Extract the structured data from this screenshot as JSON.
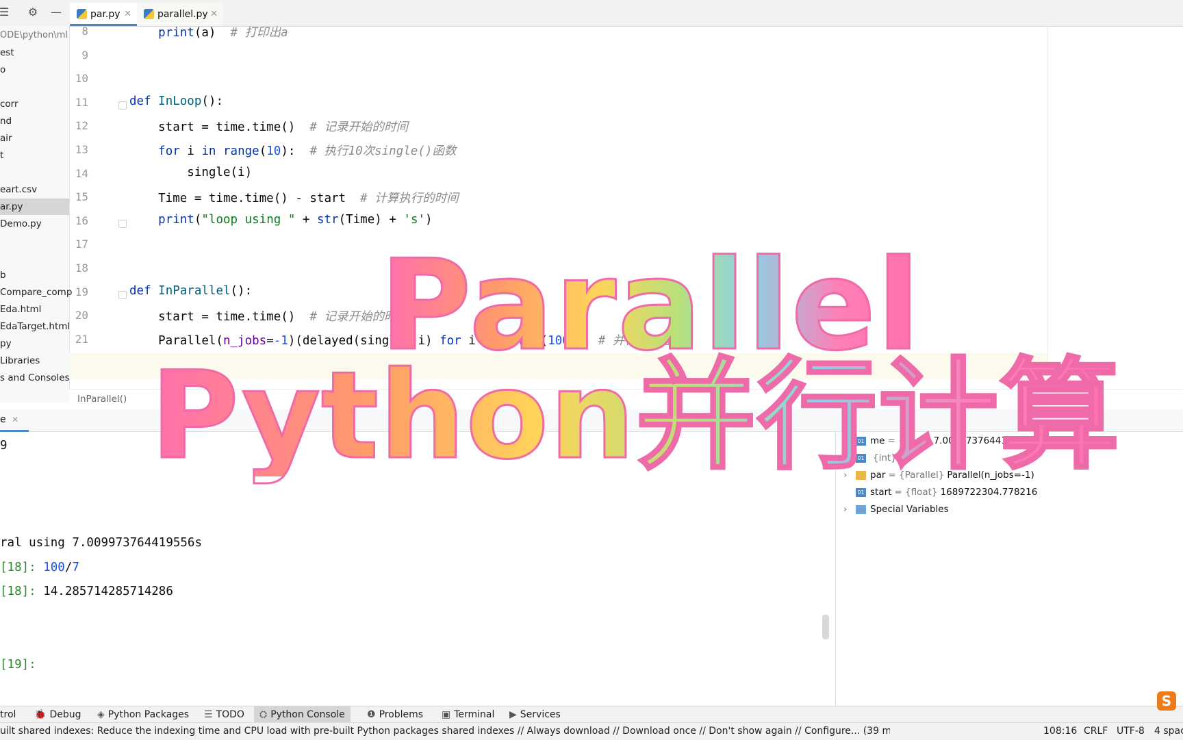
{
  "tabs": [
    {
      "label": "par.py",
      "active": true
    },
    {
      "label": "parallel.py",
      "active": false
    }
  ],
  "project_items": [
    "ODE\\python\\ml",
    "est",
    "o",
    "",
    "corr",
    "nd",
    "air",
    "t",
    "",
    "eart.csv",
    "ar.py",
    "Demo.py",
    "",
    "",
    "b",
    "Compare_comp",
    "Eda.html",
    "EdaTarget.html",
    "py",
    "Libraries",
    "s and Consoles"
  ],
  "editor": {
    "lines": [
      {
        "n": "8",
        "code": "    print(a)  ",
        "comment": "# 打印出a"
      },
      {
        "n": "9",
        "code": "",
        "comment": ""
      },
      {
        "n": "10",
        "code": "",
        "comment": ""
      },
      {
        "n": "11",
        "code": "def InLoop():",
        "comment": ""
      },
      {
        "n": "12",
        "code": "    start = time.time()  ",
        "comment": "# 记录开始的时间"
      },
      {
        "n": "13",
        "code": "    for i in range(10):  ",
        "comment": "# 执行10次single()函数"
      },
      {
        "n": "14",
        "code": "        single(i)",
        "comment": ""
      },
      {
        "n": "15",
        "code": "    Time = time.time() - start  ",
        "comment": "# 计算执行的时间"
      },
      {
        "n": "16",
        "code": "    print(\"loop using \" + str(Time) + 's')",
        "comment": ""
      },
      {
        "n": "17",
        "code": "",
        "comment": ""
      },
      {
        "n": "18",
        "code": "",
        "comment": ""
      },
      {
        "n": "19",
        "code": "def InParallel():",
        "comment": ""
      },
      {
        "n": "20",
        "code": "    start = time.time()  ",
        "comment": "# 记录开始的时间"
      },
      {
        "n": "21",
        "code": "    Parallel(n_jobs=-1)(delayed(single)(i) for i in range(100))  ",
        "comment": "# 并行化处理"
      }
    ],
    "breadcrumb": "InParallel()"
  },
  "console": {
    "tab_label": "e",
    "lines": [
      "9",
      "",
      "",
      "",
      "ral using 7.009973764419556s",
      "[18]: 100/7",
      "[18]: 14.285714285714286",
      "",
      "",
      "[19]:"
    ]
  },
  "variables": [
    {
      "expand": false,
      "icon": "01",
      "name": "me",
      "type": "= {float}",
      "value": "7.009973764419556"
    },
    {
      "expand": false,
      "icon": "01",
      "name": "",
      "type": "{int}",
      "value": "0"
    },
    {
      "expand": true,
      "icon": "list",
      "name": "par",
      "type": "= {Parallel}",
      "value": "Parallel(n_jobs=-1)"
    },
    {
      "expand": false,
      "icon": "01",
      "name": "start",
      "type": "= {float}",
      "value": "1689722304.778216"
    },
    {
      "expand": true,
      "icon": "grid",
      "name": "Special Variables",
      "type": "",
      "value": ""
    }
  ],
  "tool_windows": [
    "trol",
    "Debug",
    "Python Packages",
    "TODO",
    "Python Console",
    "Problems",
    "Terminal",
    "Services"
  ],
  "status": {
    "message": "uilt shared indexes: Reduce the indexing time and CPU load with pre-built Python packages shared indexes // Always download // Download once // Don't show again // Configure... (39 minutes ago)",
    "position": "108:16",
    "line_sep": "CRLF",
    "encoding": "UTF-8",
    "indent": "4 spac"
  },
  "overlay": {
    "title1": "Parallel",
    "title2": "Python并行计算"
  },
  "watermark": "S"
}
